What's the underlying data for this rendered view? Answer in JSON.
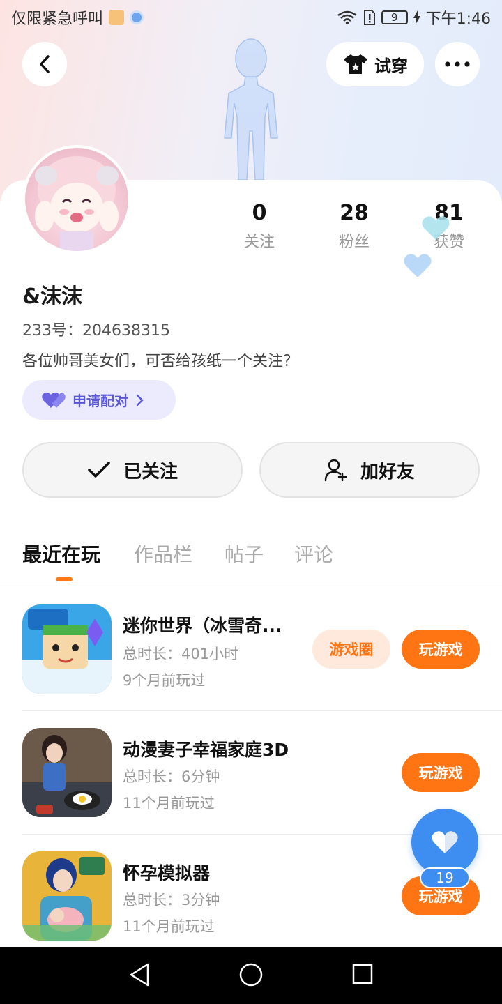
{
  "status_bar": {
    "carrier_text": "仅限紧急呼叫",
    "battery_level": "9",
    "time": "下午1:46"
  },
  "header": {
    "back_icon": "chevron-left-icon",
    "try_on_label": "试穿",
    "more_icon": "more-dots-icon"
  },
  "profile": {
    "username": "&沫沫",
    "uid_text": "233号：204638315",
    "bio": "各位帅哥美女们，可否给孩纸一个关注？",
    "pair_label": "申请配对",
    "stats": [
      {
        "value": "0",
        "label": "关注"
      },
      {
        "value": "28",
        "label": "粉丝"
      },
      {
        "value": "81",
        "label": "获赞"
      }
    ]
  },
  "actions": {
    "following_label": "已关注",
    "add_friend_label": "加好友"
  },
  "tabs": [
    {
      "label": "最近在玩",
      "active": true
    },
    {
      "label": "作品栏",
      "active": false
    },
    {
      "label": "帖子",
      "active": false
    },
    {
      "label": "评论",
      "active": false
    }
  ],
  "games": [
    {
      "title": "迷你世界（冰雪奇...",
      "duration": "总时长：401小时",
      "last_played": "9个月前玩过",
      "circle_label": "游戏圈",
      "play_label": "玩游戏"
    },
    {
      "title": "动漫妻子幸福家庭3D",
      "duration": "总时长：6分钟",
      "last_played": "11个月前玩过",
      "play_label": "玩游戏"
    },
    {
      "title": "怀孕模拟器",
      "duration": "总时长：3分钟",
      "last_played": "11个月前玩过",
      "play_label": "玩游戏"
    }
  ],
  "fab": {
    "icon": "heart-icon",
    "count": "19"
  },
  "colors": {
    "accent_orange": "#ff7514",
    "fab_blue": "#3d8ef0",
    "pair_purple": "#5b58d6"
  }
}
